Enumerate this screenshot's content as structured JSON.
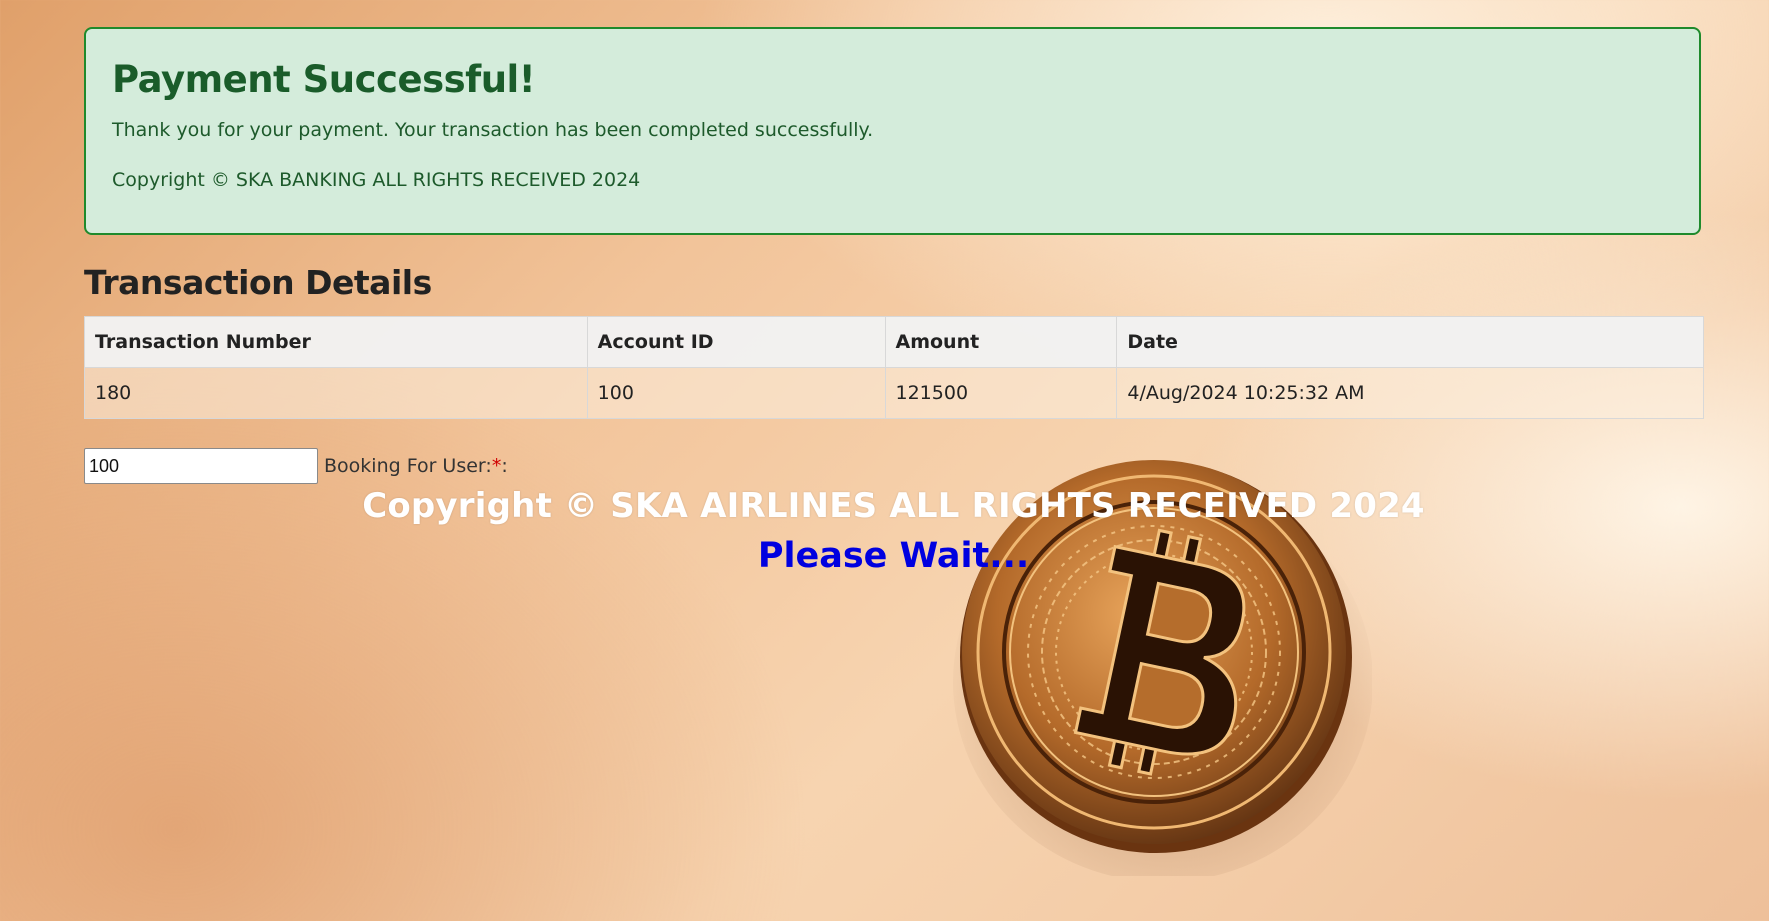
{
  "alert": {
    "title": "Payment Successful!",
    "message": "Thank you for your payment. Your transaction has been completed successfully.",
    "copyright": "Copyright © SKA BANKING ALL RIGHTS RECEIVED 2024",
    "background_color": "#d4ecdb",
    "border_color": "#1f8a2c"
  },
  "transaction_details": {
    "title": "Transaction Details",
    "columns": [
      "Transaction Number",
      "Account ID",
      "Amount",
      "Date"
    ],
    "rows": [
      [
        "180",
        "100",
        "121500",
        "4/Aug/2024 10:25:32 AM"
      ]
    ]
  },
  "booking": {
    "input_value": "100",
    "label": "Booking For User:",
    "required_marker": "*",
    "label_suffix": ":"
  },
  "footer": {
    "copyright": "Copyright © SKA AIRLINES ALL RIGHTS RECEIVED 2024",
    "wait_text": "Please Wait...",
    "wait_color": "#0000e0"
  },
  "background": {
    "image": "bitcoin-coin-icon"
  }
}
